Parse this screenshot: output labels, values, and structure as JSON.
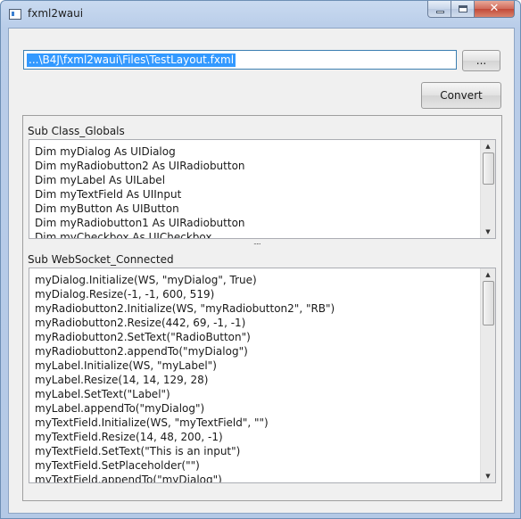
{
  "window": {
    "title": "fxml2waui"
  },
  "caption_buttons": {
    "minimize": "minimize",
    "maximize": "maximize",
    "close": "x"
  },
  "file_path": {
    "value": "...\\B4J\\fxml2waui\\Files\\TestLayout.fxml"
  },
  "browse_button": {
    "label": "..."
  },
  "convert_button": {
    "label": "Convert"
  },
  "globals_section": {
    "label": "Sub Class_Globals",
    "lines": [
      "Dim myDialog As UIDialog",
      "Dim myRadiobutton2 As UIRadiobutton",
      "Dim myLabel As UILabel",
      "Dim myTextField As UIInput",
      "Dim myButton As UIButton",
      "Dim myRadiobutton1 As UIRadiobutton",
      "Dim myCheckbox As UICheckbox"
    ]
  },
  "connected_section": {
    "label": "Sub WebSocket_Connected",
    "lines": [
      "myDialog.Initialize(WS, \"myDialog\", True)",
      "myDialog.Resize(-1, -1, 600, 519)",
      "myRadiobutton2.Initialize(WS, \"myRadiobutton2\", \"RB\")",
      "myRadiobutton2.Resize(442, 69, -1, -1)",
      "myRadiobutton2.SetText(\"RadioButton\")",
      "myRadiobutton2.appendTo(\"myDialog\")",
      "myLabel.Initialize(WS, \"myLabel\")",
      "myLabel.Resize(14, 14, 129, 28)",
      "myLabel.SetText(\"Label\")",
      "myLabel.appendTo(\"myDialog\")",
      "myTextField.Initialize(WS, \"myTextField\", \"\")",
      "myTextField.Resize(14, 48, 200, -1)",
      "myTextField.SetText(\"This is an input\")",
      "myTextField.SetPlaceholder(\"\")",
      "myTextField.appendTo(\"myDialog\")"
    ]
  },
  "splitter": {
    "grip": "....."
  },
  "colors": {
    "selection": "#3399ff",
    "input_focus_border": "#3c7fb1",
    "close_button": "#c24a38",
    "window_frame": "#b9cde9"
  }
}
